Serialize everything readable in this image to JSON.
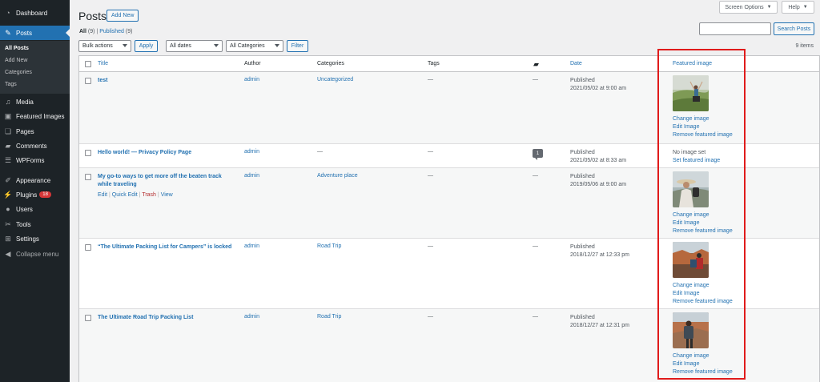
{
  "sidebar": {
    "items": [
      {
        "label": "Dashboard",
        "icon": "dashboard-icon"
      },
      {
        "label": "Posts",
        "icon": "pin-icon"
      },
      {
        "label": "Media",
        "icon": "media-icon"
      },
      {
        "label": "Featured Images",
        "icon": "featured-images-icon"
      },
      {
        "label": "Pages",
        "icon": "pages-icon"
      },
      {
        "label": "Comments",
        "icon": "comments-icon"
      },
      {
        "label": "WPForms",
        "icon": "wpforms-icon"
      },
      {
        "label": "Appearance",
        "icon": "appearance-icon"
      },
      {
        "label": "Plugins",
        "icon": "plugins-icon",
        "badge": "18"
      },
      {
        "label": "Users",
        "icon": "users-icon"
      },
      {
        "label": "Tools",
        "icon": "tools-icon"
      },
      {
        "label": "Settings",
        "icon": "settings-icon"
      },
      {
        "label": "Collapse menu",
        "icon": "collapse-icon"
      }
    ],
    "submenu": [
      "All Posts",
      "Add New",
      "Categories",
      "Tags"
    ]
  },
  "top": {
    "screen_options": "Screen Options",
    "help": "Help"
  },
  "header": {
    "title": "Posts",
    "add_new": "Add New"
  },
  "subsub": {
    "all": "All",
    "all_count": "(9)",
    "sep": "|",
    "published": "Published",
    "published_count": "(9)"
  },
  "filters": {
    "bulk": "Bulk actions",
    "apply": "Apply",
    "dates": "All dates",
    "categories": "All Categories",
    "filter": "Filter"
  },
  "search": {
    "button": "Search Posts",
    "placeholder": ""
  },
  "items_count": "9 items",
  "columns": {
    "title": "Title",
    "author": "Author",
    "categories": "Categories",
    "tags": "Tags",
    "date": "Date",
    "featured": "Featured image"
  },
  "rows": [
    {
      "title": "test",
      "author": "admin",
      "category": "Uncategorized",
      "tags": "—",
      "comments": "—",
      "status": "Published",
      "date": "2021/05/02 at 9:00 am",
      "image": "thumb-hiker-field",
      "links": [
        "Change image",
        "Edit Image",
        "Remove featured image"
      ]
    },
    {
      "title": "Hello world! — Privacy Policy Page",
      "author": "admin",
      "category": "—",
      "tags": "—",
      "comments": "1",
      "status": "Published",
      "date": "2021/05/02 at 8:33 am",
      "image": "",
      "links": [
        "No image set",
        "Set featured image"
      ]
    },
    {
      "title": "My go-to ways to get more off the beaten track while traveling",
      "author": "admin",
      "category": "Adventure place",
      "tags": "—",
      "comments": "—",
      "status": "Published",
      "date": "2019/05/06 at 9:00 am",
      "image": "thumb-traveler-hat",
      "links": [
        "Change image",
        "Edit Image",
        "Remove featured image"
      ],
      "actions": {
        "edit": "Edit",
        "quick_edit": "Quick Edit",
        "trash": "Trash",
        "view": "View",
        "sep": "|"
      }
    },
    {
      "title": "“The Ultimate Packing List for Campers” is locked",
      "author": "admin",
      "category": "Road Trip",
      "tags": "—",
      "comments": "—",
      "status": "Published",
      "date": "2018/12/27 at 12:33 pm",
      "image": "thumb-camper-canyon",
      "links": [
        "Change image",
        "Edit Image",
        "Remove featured image"
      ]
    },
    {
      "title": "The Ultimate Road Trip Packing List",
      "author": "admin",
      "category": "Road Trip",
      "tags": "—",
      "comments": "—",
      "status": "Published",
      "date": "2018/12/27 at 12:31 pm",
      "image": "thumb-backpacker-canyon",
      "links": [
        "Change image",
        "Edit Image",
        "Remove featured image"
      ]
    }
  ],
  "colors": {
    "admin_bar": "#1d2327",
    "accent": "#2271b1",
    "highlight": "#e01b1b",
    "trash": "#b32d2e"
  }
}
